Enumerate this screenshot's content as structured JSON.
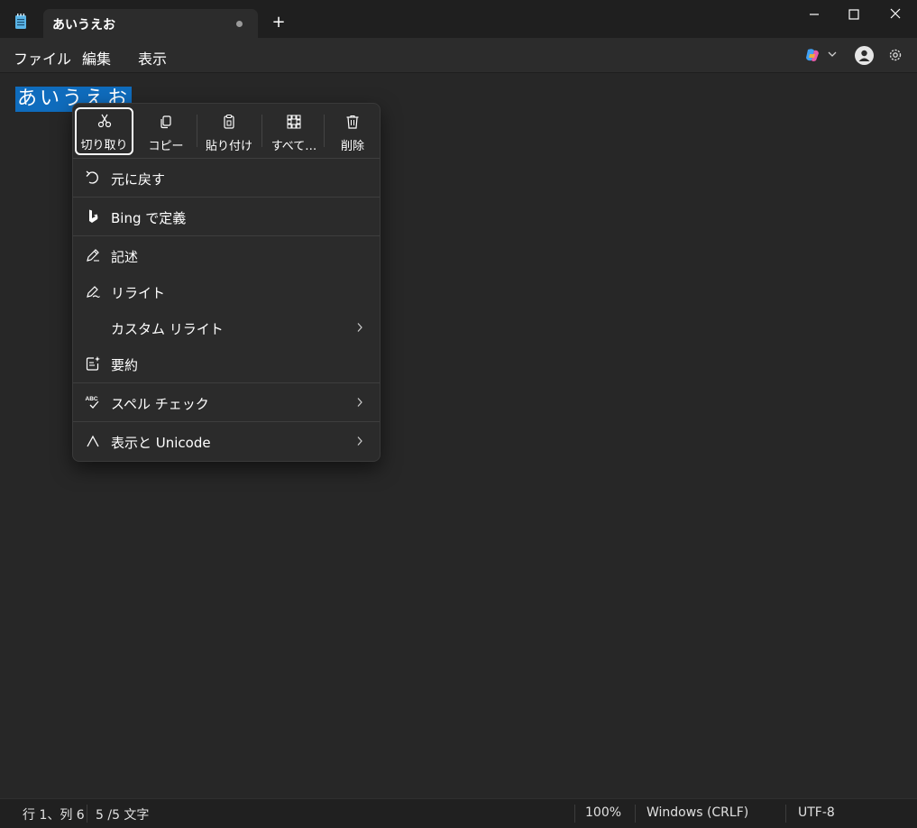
{
  "window": {
    "tab_title": "あいうえお",
    "new_tab_symbol": "+"
  },
  "menubar": {
    "file": "ファイル",
    "edit": "編集",
    "view": "表示"
  },
  "editor": {
    "text": "あいうえお"
  },
  "context_menu": {
    "quick_actions": [
      {
        "label": "切り取り",
        "icon": "scissors-icon"
      },
      {
        "label": "コピー",
        "icon": "copy-icon"
      },
      {
        "label": "貼り付け",
        "icon": "paste-icon"
      },
      {
        "label": "すべて…",
        "icon": "select-all-icon"
      },
      {
        "label": "削除",
        "icon": "trash-icon"
      }
    ],
    "undo": "元に戻す",
    "bing_define": "Bing で定義",
    "write": "記述",
    "rewrite": "リライト",
    "custom_rewrite": "カスタム リライト",
    "summarize": "要約",
    "spell_check": "スペル チェック",
    "unicode": "表示と Unicode"
  },
  "status": {
    "position": "行 1、列 6",
    "chars": "5 /5 文字",
    "zoom": "100%",
    "line_ending": "Windows (CRLF)",
    "encoding": "UTF-8"
  },
  "colors": {
    "selection": "#0f6cbd",
    "background": "#272727",
    "menu_background": "#2b2b2b"
  }
}
